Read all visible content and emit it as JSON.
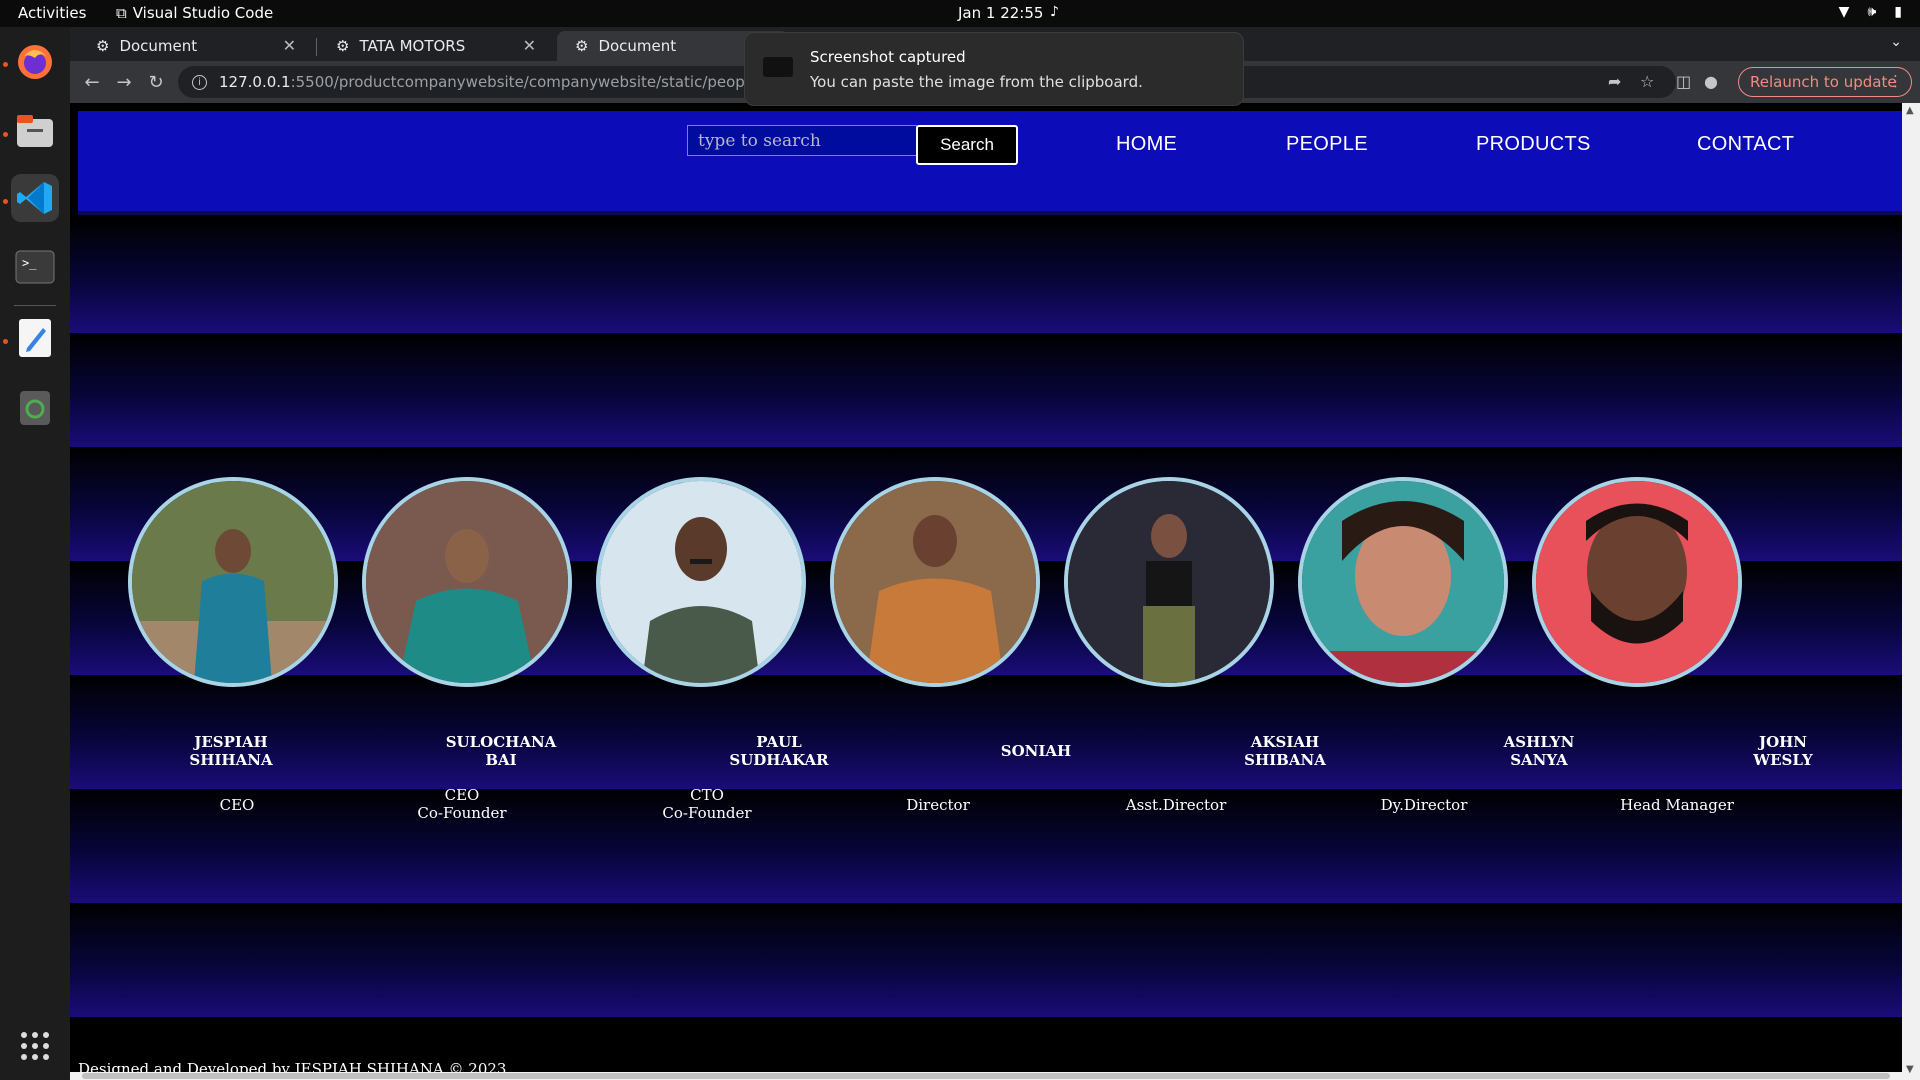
{
  "topbar": {
    "activities": "Activities",
    "app_name": "Visual Studio Code",
    "clock": "Jan 1  22:55"
  },
  "dock": {
    "items": [
      "firefox-icon",
      "files-icon",
      "vscode-icon",
      "terminal-icon",
      "text-editor-icon",
      "trash-icon",
      "app-grid-icon"
    ]
  },
  "browser": {
    "tabs": [
      {
        "title": "Document"
      },
      {
        "title": "TATA MOTORS"
      },
      {
        "title": "Document"
      }
    ],
    "url_host": "127.0.0.1",
    "url_rest": ":5500/productcompanywebsite/companywebsite/static/people.html",
    "relaunch_label": "Relaunch to update"
  },
  "notification": {
    "title": "Screenshot captured",
    "body": "You can paste the image from the clipboard."
  },
  "site": {
    "search_placeholder": "type to search",
    "search_button": "Search",
    "nav": [
      "HOME",
      "PEOPLE",
      "PRODUCTS",
      "CONTACT"
    ],
    "people": [
      {
        "name_line1": "JESPIAH",
        "name_line2": "SHIHANA",
        "role_line1": "CEO",
        "role_line2": ""
      },
      {
        "name_line1": "SULOCHANA",
        "name_line2": "BAI",
        "role_line1": "CEO",
        "role_line2": "Co-Founder"
      },
      {
        "name_line1": "PAUL",
        "name_line2": "SUDHAKAR",
        "role_line1": "CTO",
        "role_line2": "Co-Founder"
      },
      {
        "name_line1": "SONIAH",
        "name_line2": "",
        "role_line1": "Director",
        "role_line2": ""
      },
      {
        "name_line1": "AKSIAH",
        "name_line2": "SHIBANA",
        "role_line1": "Asst.Director",
        "role_line2": ""
      },
      {
        "name_line1": "ASHLYN",
        "name_line2": "SANYA",
        "role_line1": "Dy.Director",
        "role_line2": ""
      },
      {
        "name_line1": "JOHN",
        "name_line2": "WESLY",
        "role_line1": "Head Manager",
        "role_line2": ""
      }
    ],
    "footer": "Designed and Developed by JESPIAH SHIHANA © 2023"
  },
  "colors": {
    "header_bg": "#0c0cb8",
    "band_bottom": "#1a0c78",
    "photo_border": "#a8d4e6",
    "relaunch_accent": "#f28b82"
  }
}
